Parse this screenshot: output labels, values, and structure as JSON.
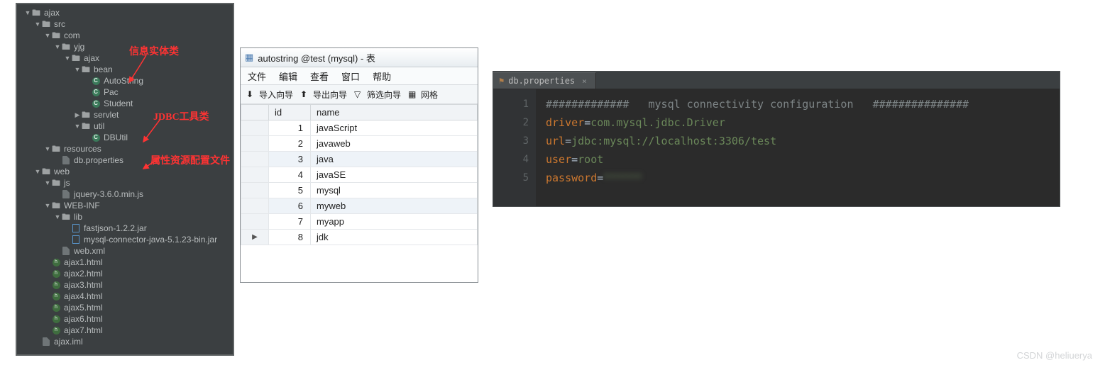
{
  "watermark": "CSDN @heliuerya",
  "tree": {
    "annotations": {
      "a1": "信息实体类",
      "a2": "JDBC工具类",
      "a3": "属性资源配置文件"
    },
    "items": [
      {
        "d": 0,
        "exp": true,
        "kind": "folder",
        "label": "ajax"
      },
      {
        "d": 1,
        "exp": true,
        "kind": "folder",
        "label": "src"
      },
      {
        "d": 2,
        "exp": true,
        "kind": "folder",
        "label": "com"
      },
      {
        "d": 3,
        "exp": true,
        "kind": "folder",
        "label": "yjg"
      },
      {
        "d": 4,
        "exp": true,
        "kind": "folder",
        "label": "ajax"
      },
      {
        "d": 5,
        "exp": true,
        "kind": "folder",
        "label": "bean"
      },
      {
        "d": 6,
        "kind": "class",
        "label": "AutoString"
      },
      {
        "d": 6,
        "kind": "class",
        "label": "Pac"
      },
      {
        "d": 6,
        "kind": "class",
        "label": "Student"
      },
      {
        "d": 5,
        "exp": false,
        "kind": "folder",
        "label": "servlet"
      },
      {
        "d": 5,
        "exp": true,
        "kind": "folder",
        "label": "util"
      },
      {
        "d": 6,
        "kind": "class",
        "label": "DBUtil"
      },
      {
        "d": 2,
        "exp": true,
        "kind": "folder",
        "label": "resources"
      },
      {
        "d": 3,
        "kind": "file",
        "label": "db.properties"
      },
      {
        "d": 1,
        "exp": true,
        "kind": "folder",
        "label": "web"
      },
      {
        "d": 2,
        "exp": true,
        "kind": "folder",
        "label": "js"
      },
      {
        "d": 3,
        "kind": "file",
        "label": "jquery-3.6.0.min.js"
      },
      {
        "d": 2,
        "exp": true,
        "kind": "folder",
        "label": "WEB-INF"
      },
      {
        "d": 3,
        "exp": true,
        "kind": "folder",
        "label": "lib"
      },
      {
        "d": 4,
        "kind": "jar",
        "label": "fastjson-1.2.2.jar"
      },
      {
        "d": 4,
        "kind": "jar",
        "label": "mysql-connector-java-5.1.23-bin.jar"
      },
      {
        "d": 3,
        "kind": "file",
        "label": "web.xml"
      },
      {
        "d": 2,
        "kind": "html",
        "label": "ajax1.html"
      },
      {
        "d": 2,
        "kind": "html",
        "label": "ajax2.html"
      },
      {
        "d": 2,
        "kind": "html",
        "label": "ajax3.html"
      },
      {
        "d": 2,
        "kind": "html",
        "label": "ajax4.html"
      },
      {
        "d": 2,
        "kind": "html",
        "label": "ajax5.html"
      },
      {
        "d": 2,
        "kind": "html",
        "label": "ajax6.html"
      },
      {
        "d": 2,
        "kind": "html",
        "label": "ajax7.html"
      },
      {
        "d": 1,
        "kind": "file",
        "label": "ajax.iml"
      }
    ]
  },
  "db": {
    "title": "autostring @test (mysql) - 表",
    "menu": [
      "文件",
      "编辑",
      "查看",
      "窗口",
      "帮助"
    ],
    "tools": [
      "导入向导",
      "导出向导",
      "筛选向导",
      "网格"
    ],
    "columns": [
      "id",
      "name"
    ],
    "rows": [
      {
        "id": "1",
        "name": "javaScript"
      },
      {
        "id": "2",
        "name": "javaweb"
      },
      {
        "id": "3",
        "name": "java"
      },
      {
        "id": "4",
        "name": "javaSE"
      },
      {
        "id": "5",
        "name": "mysql"
      },
      {
        "id": "6",
        "name": "myweb"
      },
      {
        "id": "7",
        "name": "myapp"
      },
      {
        "id": "8",
        "name": "jdk"
      }
    ]
  },
  "editor": {
    "tab": "db.properties",
    "lines": [
      {
        "n": "1",
        "type": "comment",
        "text": "#############   mysql connectivity configuration   ###############"
      },
      {
        "n": "2",
        "type": "kv",
        "key": "driver",
        "val": "com.mysql.jdbc.Driver"
      },
      {
        "n": "3",
        "type": "kv",
        "key": "url",
        "val": "jdbc:mysql://localhost:3306/test"
      },
      {
        "n": "4",
        "type": "kv",
        "key": "user",
        "val": "root"
      },
      {
        "n": "5",
        "type": "kvblur",
        "key": "password",
        "val": "******"
      }
    ]
  }
}
